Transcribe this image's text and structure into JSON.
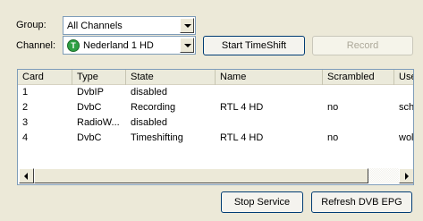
{
  "group": {
    "label": "Group:",
    "value": "All Channels"
  },
  "channel": {
    "label": "Channel:",
    "value": "Nederland 1 HD",
    "badge": "T"
  },
  "buttons": {
    "start_timeshift": "Start TimeShift",
    "record": "Record",
    "stop_service": "Stop Service",
    "refresh_epg": "Refresh DVB EPG"
  },
  "table": {
    "columns": [
      "Card",
      "Type",
      "State",
      "Name",
      "Scrambled",
      "Use"
    ],
    "rows": [
      [
        "1",
        "DvbIP",
        "disabled",
        "",
        "",
        ""
      ],
      [
        "2",
        "DvbC",
        "Recording",
        "RTL 4 HD",
        "no",
        "sch"
      ],
      [
        "3",
        "RadioW...",
        "disabled",
        "",
        "",
        ""
      ],
      [
        "4",
        "DvbC",
        "Timeshifting",
        "RTL 4 HD",
        "no",
        "wol"
      ]
    ]
  },
  "colors": {
    "badge_green": "#2ea043",
    "border_blue": "#7f9db9",
    "window_bg": "#ece9d8"
  }
}
